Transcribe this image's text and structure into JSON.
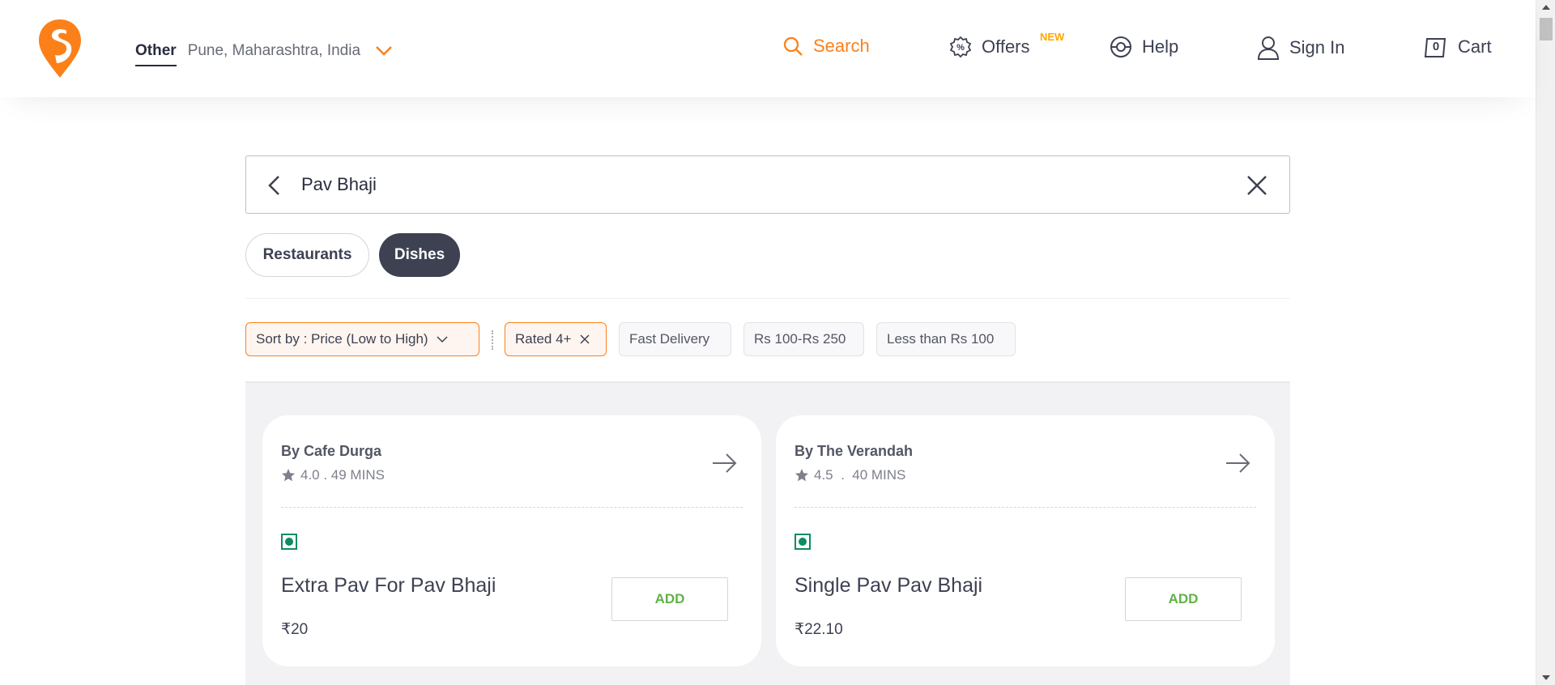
{
  "header": {
    "location_type": "Other",
    "location_address": "Pune, Maharashtra, India",
    "nav": {
      "search": "Search",
      "offers": "Offers",
      "offers_badge": "NEW",
      "help": "Help",
      "signin": "Sign In",
      "cart": "Cart",
      "cart_count": "0"
    }
  },
  "search": {
    "query": "Pav Bhaji"
  },
  "tabs": {
    "restaurants": "Restaurants",
    "dishes": "Dishes",
    "active": "Dishes"
  },
  "filters": {
    "sort": "Sort by : Price (Low to High)",
    "rated": "Rated 4+",
    "fast_delivery": "Fast Delivery",
    "price_range": "Rs 100-Rs 250",
    "less_than": "Less than Rs 100"
  },
  "results": [
    {
      "restaurant": "By Cafe Durga",
      "meta": "4.0 . 49 MINS",
      "dish": "Extra Pav For Pav Bhaji",
      "price": "₹20",
      "add_label": "ADD",
      "veg": true
    },
    {
      "restaurant": "By The Verandah",
      "meta": "4.5  .  40 MINS",
      "dish": "Single Pav Pav Bhaji",
      "price": "₹22.10",
      "add_label": "ADD",
      "veg": true
    }
  ],
  "colors": {
    "brand_orange": "#fc8019",
    "veg_green": "#0f8a65",
    "add_green": "#60b246",
    "dark_tab": "#3d4152"
  }
}
